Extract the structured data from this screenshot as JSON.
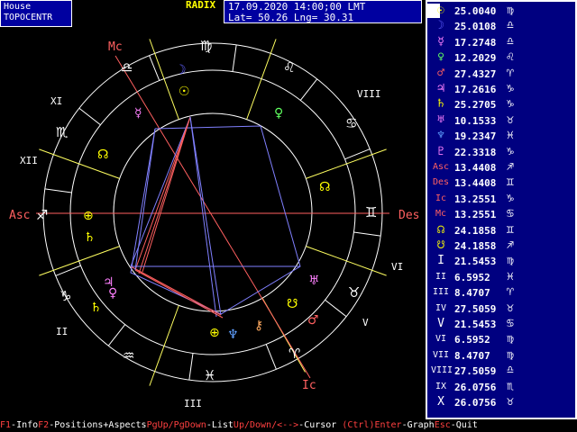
{
  "header": {
    "house_line1": "House",
    "house_line2": "TOPOCENTR",
    "radix": "RADIX",
    "datetime": "17.09.2020 14:00;00 LMT",
    "coords": "Lat= 50.26 Lng= 30.31"
  },
  "wheel_labels": {
    "mc": "Mc",
    "asc": "Asc",
    "des": "Des",
    "ic": "Ic",
    "houses": [
      "I",
      "II",
      "III",
      "IV",
      "V",
      "VI",
      "VII",
      "VIII",
      "IX",
      "X",
      "XI",
      "XII"
    ]
  },
  "planets": [
    {
      "glyph": "☉",
      "degree": "25.0040",
      "sign": "♍",
      "color": "#ffff00"
    },
    {
      "glyph": "☽",
      "degree": "25.0108",
      "sign": "♎",
      "color": "#6060ff"
    },
    {
      "glyph": "☿",
      "degree": "17.2748",
      "sign": "♎",
      "color": "#ff80ff"
    },
    {
      "glyph": "♀",
      "degree": "12.2029",
      "sign": "♌",
      "color": "#60ff60"
    },
    {
      "glyph": "♂",
      "degree": "27.4327",
      "sign": "♈",
      "color": "#ff6060"
    },
    {
      "glyph": "♃",
      "degree": "17.2616",
      "sign": "♑",
      "color": "#ff80ff"
    },
    {
      "glyph": "♄",
      "degree": "25.2705",
      "sign": "♑",
      "color": "#ffff00"
    },
    {
      "glyph": "♅",
      "degree": "10.1533",
      "sign": "♉",
      "color": "#ff80ff"
    },
    {
      "glyph": "♆",
      "degree": "19.2347",
      "sign": "♓",
      "color": "#60a0ff"
    },
    {
      "glyph": "♇",
      "degree": "22.3318",
      "sign": "♑",
      "color": "#ff80ff"
    },
    {
      "glyph": "Asc",
      "degree": "13.4408",
      "sign": "♐",
      "color": "#ff6060"
    },
    {
      "glyph": "Des",
      "degree": "13.4408",
      "sign": "♊",
      "color": "#ff6060"
    },
    {
      "glyph": "Ic",
      "degree": "13.2551",
      "sign": "♑",
      "color": "#ff6060"
    },
    {
      "glyph": "Mc",
      "degree": "13.2551",
      "sign": "♋",
      "color": "#ff6060"
    },
    {
      "glyph": "☊",
      "degree": "24.1858",
      "sign": "♊",
      "color": "#ffff00"
    },
    {
      "glyph": "☋",
      "degree": "24.1858",
      "sign": "♐",
      "color": "#ffff00"
    },
    {
      "glyph": "I",
      "degree": "21.5453",
      "sign": "♍",
      "color": "#ffffff"
    },
    {
      "glyph": "II",
      "degree": "6.5952",
      "sign": "♓",
      "color": "#ffffff"
    },
    {
      "glyph": "III",
      "degree": "8.4707",
      "sign": "♈",
      "color": "#ffffff"
    },
    {
      "glyph": "IV",
      "degree": "27.5059",
      "sign": "♉",
      "color": "#ffffff"
    },
    {
      "glyph": "V",
      "degree": "21.5453",
      "sign": "♋",
      "color": "#ffffff"
    },
    {
      "glyph": "VI",
      "degree": "6.5952",
      "sign": "♍",
      "color": "#ffffff"
    },
    {
      "glyph": "VII",
      "degree": "8.4707",
      "sign": "♍",
      "color": "#ffffff"
    },
    {
      "glyph": "VIII",
      "degree": "27.5059",
      "sign": "♎",
      "color": "#ffffff"
    },
    {
      "glyph": "IX",
      "degree": "26.0756",
      "sign": "♏",
      "color": "#ffffff"
    },
    {
      "glyph": "X",
      "degree": "26.0756",
      "sign": "♉",
      "color": "#ffffff"
    }
  ],
  "status_bar": [
    {
      "key": "F1",
      "text": "-Info"
    },
    {
      "key": "F2",
      "text": "-Positions+Aspects"
    },
    {
      "key": "PgUp/PgDown",
      "text": "-List"
    },
    {
      "key": "Up/Down/<-->",
      "text": "-Cursor "
    },
    {
      "key": "(Ctrl)Enter",
      "text": "-Graph"
    },
    {
      "key": "Esc",
      "text": "-Quit"
    }
  ]
}
